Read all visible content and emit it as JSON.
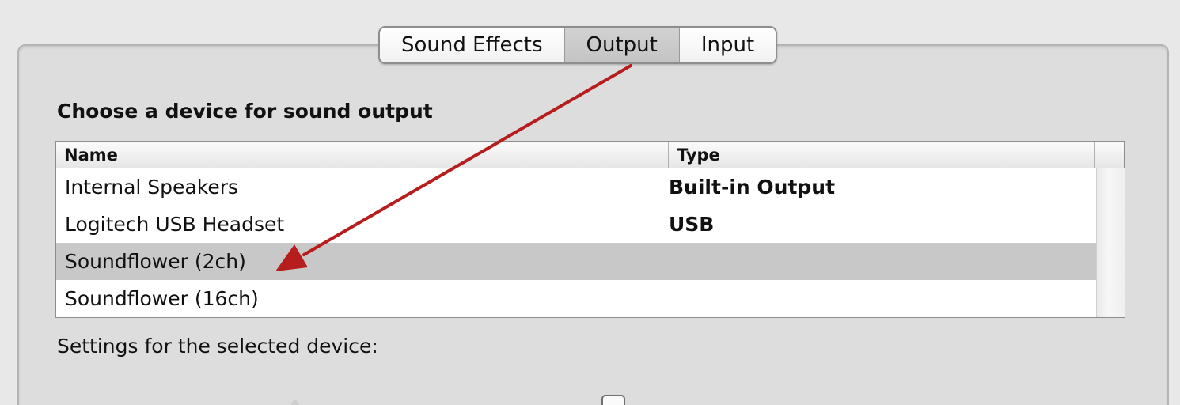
{
  "tabs": [
    {
      "label": "Sound Effects",
      "selected": false
    },
    {
      "label": "Output",
      "selected": true
    },
    {
      "label": "Input",
      "selected": false
    }
  ],
  "heading": "Choose a device for sound output",
  "table": {
    "columns": {
      "name": "Name",
      "type": "Type"
    },
    "rows": [
      {
        "name": "Internal Speakers",
        "type": "Built-in Output",
        "selected": false
      },
      {
        "name": "Logitech USB Headset",
        "type": "USB",
        "selected": false
      },
      {
        "name": "Soundflower (2ch)",
        "type": "",
        "selected": true
      },
      {
        "name": "Soundflower (16ch)",
        "type": "",
        "selected": false
      }
    ]
  },
  "settings_label": "Settings for the selected device:",
  "colors": {
    "annotation_arrow": "#b81d1d",
    "selected_row": "#c8c8c8",
    "selected_tab": "#c8c8c8"
  }
}
